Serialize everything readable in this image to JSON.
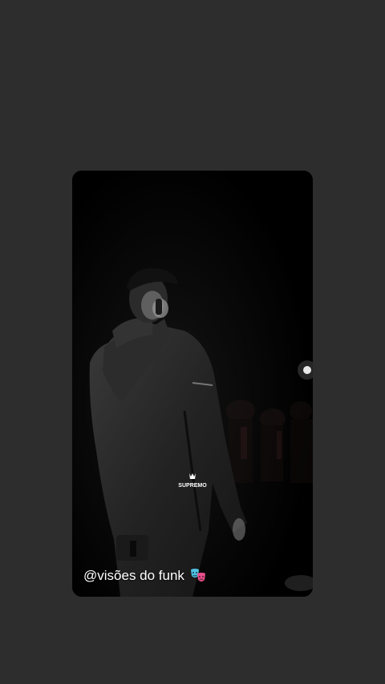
{
  "story": {
    "caption": "@visões do funk",
    "caption_icon": "theater-masks-icon",
    "watermark_text": "SUPREMO",
    "watermark_icon": "crown-icon"
  },
  "colors": {
    "page_background": "#2e2d2d",
    "card_background": "#000000",
    "caption_text": "#ffffff",
    "mask_blue": "#4ec3e6",
    "mask_pink": "#e8508c"
  }
}
